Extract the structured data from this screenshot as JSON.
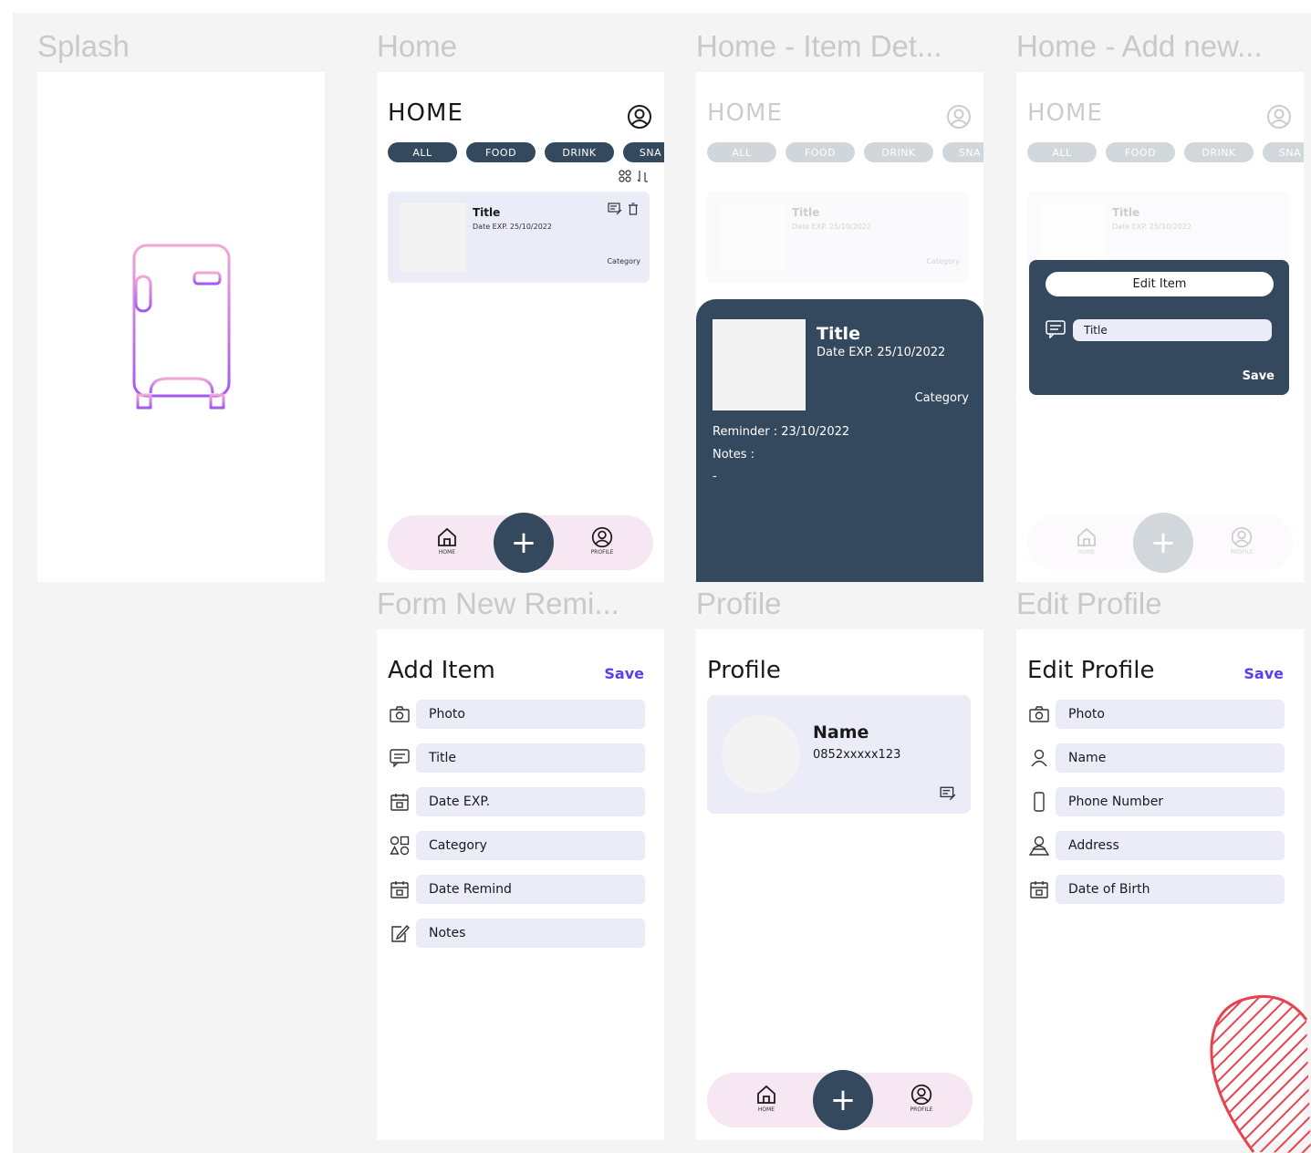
{
  "frames": {
    "splash": "Splash",
    "home": "Home",
    "detail": "Home - Item Det...",
    "add": "Home - Add new...",
    "form": "Form New Remi...",
    "profile": "Profile",
    "edit": "Edit Profile"
  },
  "home": {
    "title": "HOME",
    "chips": [
      "ALL",
      "FOOD",
      "DRINK",
      "SNA"
    ],
    "item": {
      "title": "Title",
      "date": "Date EXP. 25/10/2022",
      "category": "Category"
    },
    "nav": {
      "home": "HOME",
      "profile": "PROFILE",
      "add": "+"
    }
  },
  "detail": {
    "title": "Title",
    "date": "Date EXP. 25/10/2022",
    "category": "Category",
    "reminder": "Reminder : 23/10/2022",
    "notes": "Notes :",
    "notes_value": "-"
  },
  "edit_item": {
    "heading": "Edit Item",
    "field": "Title",
    "save": "Save"
  },
  "form": {
    "title": "Add Item",
    "save": "Save",
    "fields": [
      "Photo",
      "Title",
      "Date EXP.",
      "Category",
      "Date Remind",
      "Notes"
    ]
  },
  "profile": {
    "title": "Profile",
    "name": "Name",
    "phone": "0852xxxxx123"
  },
  "edit_profile": {
    "title": "Edit Profile",
    "save": "Save",
    "fields": [
      "Photo",
      "Name",
      "Phone Number",
      "Address",
      "Date of Birth"
    ]
  },
  "colors": {
    "navy": "#34495e",
    "lavender": "#ecebf8",
    "pink": "#f7e7f3",
    "accent": "#5b3df5"
  }
}
